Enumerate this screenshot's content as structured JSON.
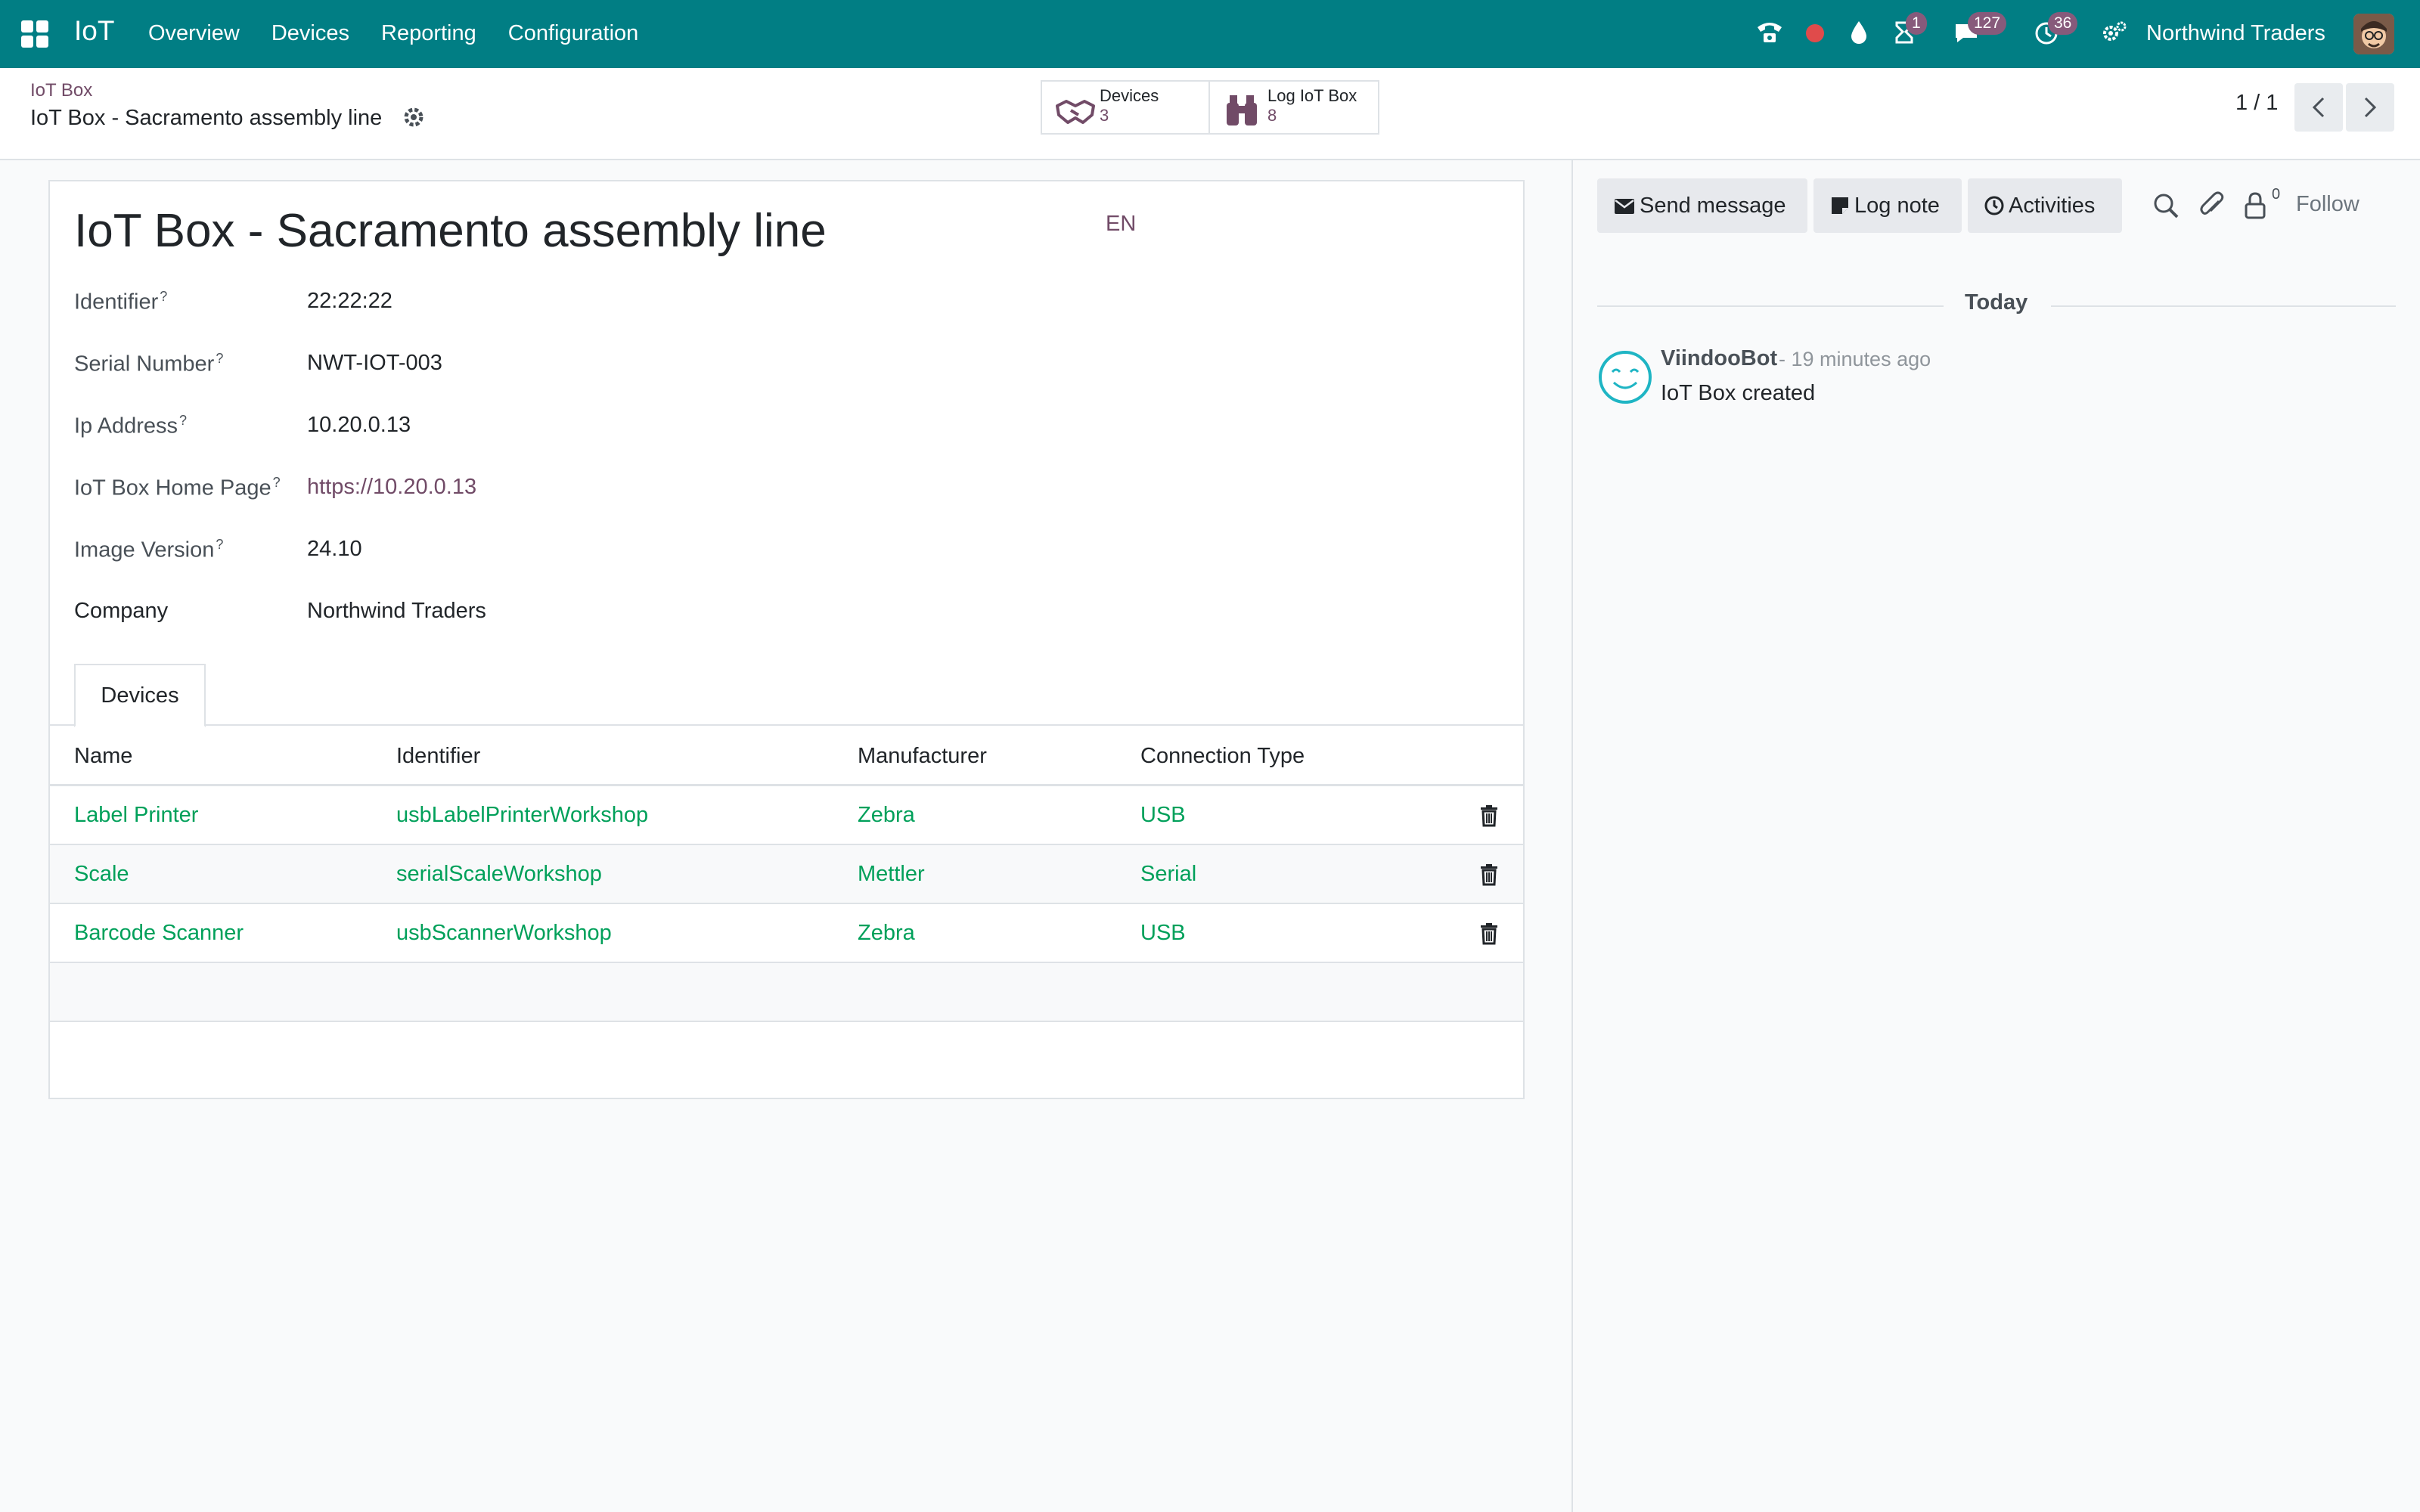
{
  "navbar": {
    "app_name": "IoT",
    "menu": [
      "Overview",
      "Devices",
      "Reporting",
      "Configuration"
    ],
    "badges": {
      "activities": "1",
      "messages": "127",
      "timer": "36"
    },
    "company": "Northwind Traders",
    "icons": [
      "apps-icon",
      "phone-icon",
      "record-icon",
      "drop-icon",
      "hourglass-icon",
      "chat-icon",
      "clock-icon",
      "settings-icon",
      "user-avatar"
    ]
  },
  "control_panel": {
    "breadcrumb": "IoT Box",
    "current": "IoT Box - Sacramento assembly line",
    "smart_buttons": [
      {
        "label": "Devices",
        "value": "3"
      },
      {
        "label": "Log IoT Box",
        "value": "8"
      }
    ],
    "pager": "1 / 1"
  },
  "form": {
    "title": "IoT Box - Sacramento assembly line",
    "lang": "EN",
    "fields": [
      {
        "label": "Identifier",
        "value": "22:22:22"
      },
      {
        "label": "Serial Number",
        "value": "NWT-IOT-003"
      },
      {
        "label": "Ip Address",
        "value": "10.20.0.13"
      },
      {
        "label": "IoT Box Home Page",
        "value": "https://10.20.0.13"
      },
      {
        "label": "Image Version",
        "value": "24.10"
      },
      {
        "label": "Company",
        "value": "Northwind Traders"
      }
    ],
    "help_mark": "?",
    "tab": "Devices",
    "table": {
      "columns": [
        "Name",
        "Identifier",
        "Manufacturer",
        "Connection Type"
      ],
      "rows": [
        [
          "Label Printer",
          "usbLabelPrinterWorkshop",
          "Zebra",
          "USB"
        ],
        [
          "Scale",
          "serialScaleWorkshop",
          "Mettler",
          "Serial"
        ],
        [
          "Barcode Scanner",
          "usbScannerWorkshop",
          "Zebra",
          "USB"
        ]
      ]
    }
  },
  "chatter": {
    "send_message": "Send message",
    "log_note": "Log note",
    "activities": "Activities",
    "followers": "0",
    "follow": "Follow",
    "date_separator": "Today",
    "message": {
      "author": "ViindooBot",
      "time": "- 19 minutes ago",
      "body": "IoT Box created"
    }
  },
  "colors": {
    "navbar": "#017e84",
    "link": "#714b67",
    "table_link": "#00a05a"
  }
}
